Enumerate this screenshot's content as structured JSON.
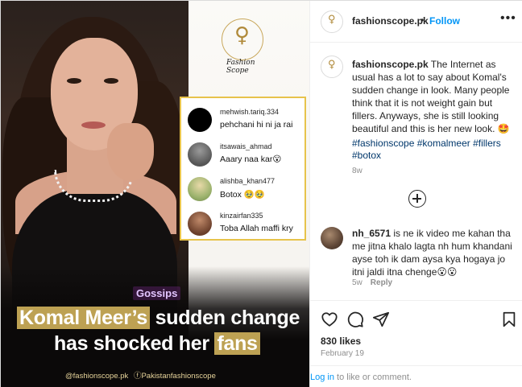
{
  "post": {
    "image": {
      "logo_text": "Fashion Scope",
      "comments": [
        {
          "username": "mehwish.tariq.334",
          "text": "pehchani hi ni ja rai",
          "avatar_color": "#000000"
        },
        {
          "username": "itsawais_ahmad",
          "text": "Aaary naa kar😮",
          "avatar_color": "#6b6b6b"
        },
        {
          "username": "alishba_khan477",
          "text": "Botox 🥹🥹",
          "avatar_color": "#c9b071"
        },
        {
          "username": "kinzairfan335",
          "text": "Toba Allah maffi kry",
          "avatar_color": "#7a4a36"
        }
      ],
      "tag": "Gossips",
      "headline": {
        "line1_highlight": "Komal Meer’s",
        "line1_rest": " sudden change",
        "line2_rest": "has shocked her ",
        "line2_highlight": "fans"
      },
      "footer_handle_1": "@fashionscope.pk",
      "footer_handle_2": "ⓕPakistanfashionscope",
      "highlight_color": "#bda153"
    },
    "header": {
      "username": "fashionscope.pk",
      "separator": "•",
      "follow_label": "Follow",
      "more_icon": "more-horizontal-icon"
    },
    "caption": {
      "username": "fashionscope.pk",
      "text": " The Internet as usual has a lot to say about Komal's sudden change in look. Many people think that it is not weight gain but fillers. Anyways, she is still looking beautiful and this is her new look. 🤩",
      "hashtags": "#fashionscope #komalmeer #fillers #botox",
      "age": "8w"
    },
    "comment": {
      "username": "nh_6571",
      "text": " is ne ik video me kahan tha me jitna khalo lagta nh hum khandani ayse toh ik dam aysa kya hogaya jo itni jaldi itna chenge😮😮",
      "age": "5w",
      "reply_label": "Reply"
    },
    "actions": {
      "like_icon": "heart-icon",
      "comment_icon": "comment-icon",
      "share_icon": "share-icon",
      "save_icon": "bookmark-icon"
    },
    "likes": "830 likes",
    "date": "February 19",
    "login": {
      "link": "Log in",
      "rest": " to like or comment."
    },
    "colors": {
      "accent": "#0095f6",
      "hashtag": "#00376b",
      "muted": "#8e8e8e",
      "card_border": "#e7c34b"
    }
  }
}
